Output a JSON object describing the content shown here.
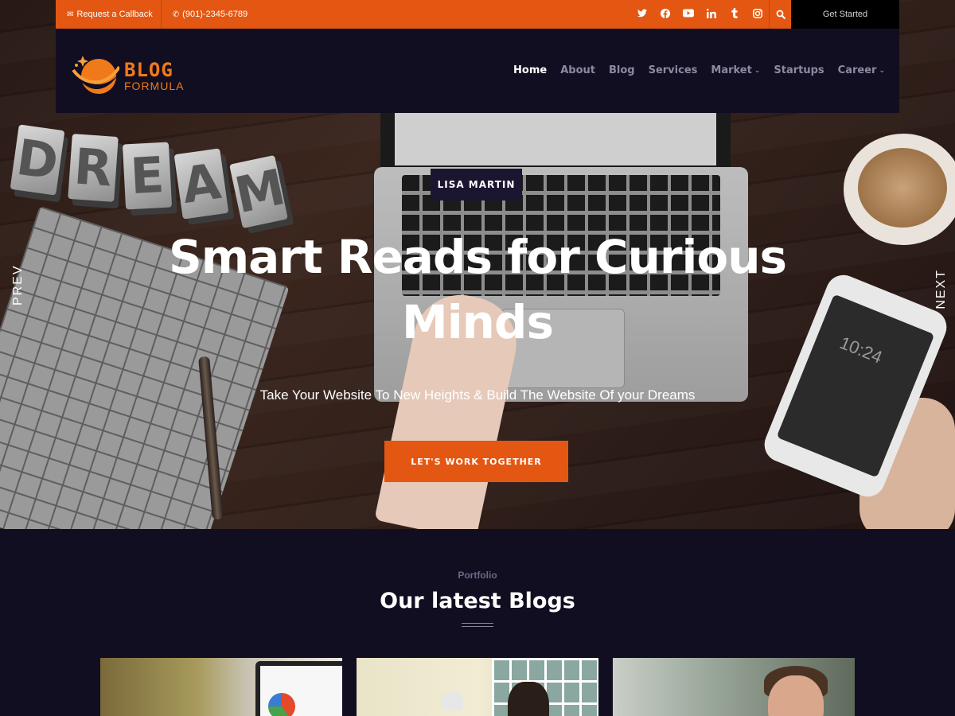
{
  "topbar": {
    "callback_label": "Request a Callback",
    "callback_icon": "envelope-icon",
    "phone_label": "(901)-2345-6789",
    "phone_icon": "phone-icon",
    "socials": [
      "twitter-icon",
      "facebook-icon",
      "youtube-icon",
      "linkedin-icon",
      "tumblr-icon",
      "instagram-icon"
    ],
    "search_icon": "search-icon",
    "get_started_label": "Get Started",
    "accent_color": "#e45712"
  },
  "logo": {
    "line1": "BLOG",
    "line2": "FORMULA",
    "color": "#f07a1a"
  },
  "nav": {
    "items": [
      {
        "label": "Home",
        "active": true,
        "dropdown": false
      },
      {
        "label": "About",
        "active": false,
        "dropdown": false
      },
      {
        "label": "Blog",
        "active": false,
        "dropdown": false
      },
      {
        "label": "Services",
        "active": false,
        "dropdown": false
      },
      {
        "label": "Market",
        "active": false,
        "dropdown": true
      },
      {
        "label": "Startups",
        "active": false,
        "dropdown": false
      },
      {
        "label": "Career",
        "active": false,
        "dropdown": true
      }
    ]
  },
  "hero": {
    "author": "LISA MARTIN",
    "title": "Smart Reads for Curious Minds",
    "subtitle": "Take Your Website To New Heights & Build The Website Of your Dreams",
    "cta_label": "LET'S WORK TOGETHER",
    "prev_label": "PREV",
    "next_label": "NEXT",
    "dream_letters": [
      "D",
      "R",
      "E",
      "A",
      "M"
    ],
    "phone_time": "10:24"
  },
  "blogs": {
    "eyebrow": "Portfolio",
    "title": "Our latest Blogs"
  },
  "colors": {
    "dark_bg": "#120e22",
    "accent": "#e45712"
  }
}
